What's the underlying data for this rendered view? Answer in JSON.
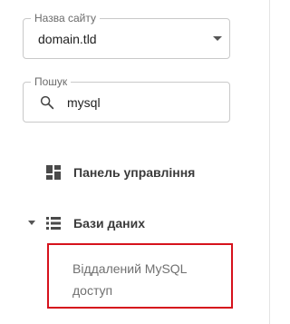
{
  "site_selector": {
    "label": "Назва сайту",
    "value": "domain.tld",
    "icon": "chevron-down-icon"
  },
  "search": {
    "label": "Пошук",
    "value": "mysql",
    "icon": "search-icon"
  },
  "nav": {
    "dashboard": {
      "label": "Панель управління",
      "icon": "dashboard-icon"
    },
    "databases": {
      "label": "Бази даних",
      "icon": "list-icon",
      "expanded": true,
      "children": [
        {
          "label": "Віддалений MySQL доступ"
        }
      ]
    }
  },
  "highlight_color": "#d6121c"
}
